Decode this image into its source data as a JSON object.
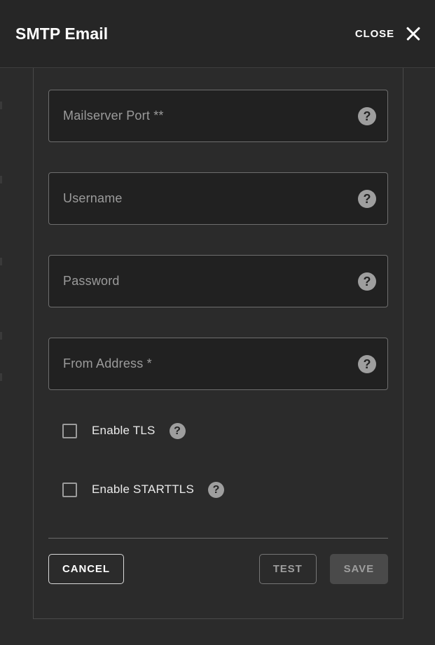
{
  "header": {
    "title": "SMTP Email",
    "close_label": "CLOSE",
    "close_icon": "close-x-icon"
  },
  "form": {
    "fields": [
      {
        "label": "Mailserver Port **",
        "value": "",
        "help_icon": "help-circle-icon"
      },
      {
        "label": "Username",
        "value": "",
        "help_icon": "help-circle-icon"
      },
      {
        "label": "Password",
        "value": "",
        "help_icon": "help-circle-icon"
      },
      {
        "label": "From Address *",
        "value": "",
        "help_icon": "help-circle-icon"
      }
    ],
    "checkboxes": [
      {
        "label": "Enable TLS",
        "checked": false,
        "help_icon": "help-circle-icon"
      },
      {
        "label": "Enable STARTTLS",
        "checked": false,
        "help_icon": "help-circle-icon"
      }
    ]
  },
  "footer": {
    "cancel_label": "CANCEL",
    "test_label": "TEST",
    "save_label": "SAVE"
  },
  "colors": {
    "header_bg": "#262626",
    "body_bg": "#2b2b2b",
    "input_bg": "#212121",
    "input_border": "#6e6e6e",
    "placeholder_text": "#9b9b9b",
    "help_icon_bg": "#9e9e9e",
    "save_bg": "#4a4a4a",
    "save_text": "#9e9e9e",
    "cancel_text": "#ffffff"
  }
}
